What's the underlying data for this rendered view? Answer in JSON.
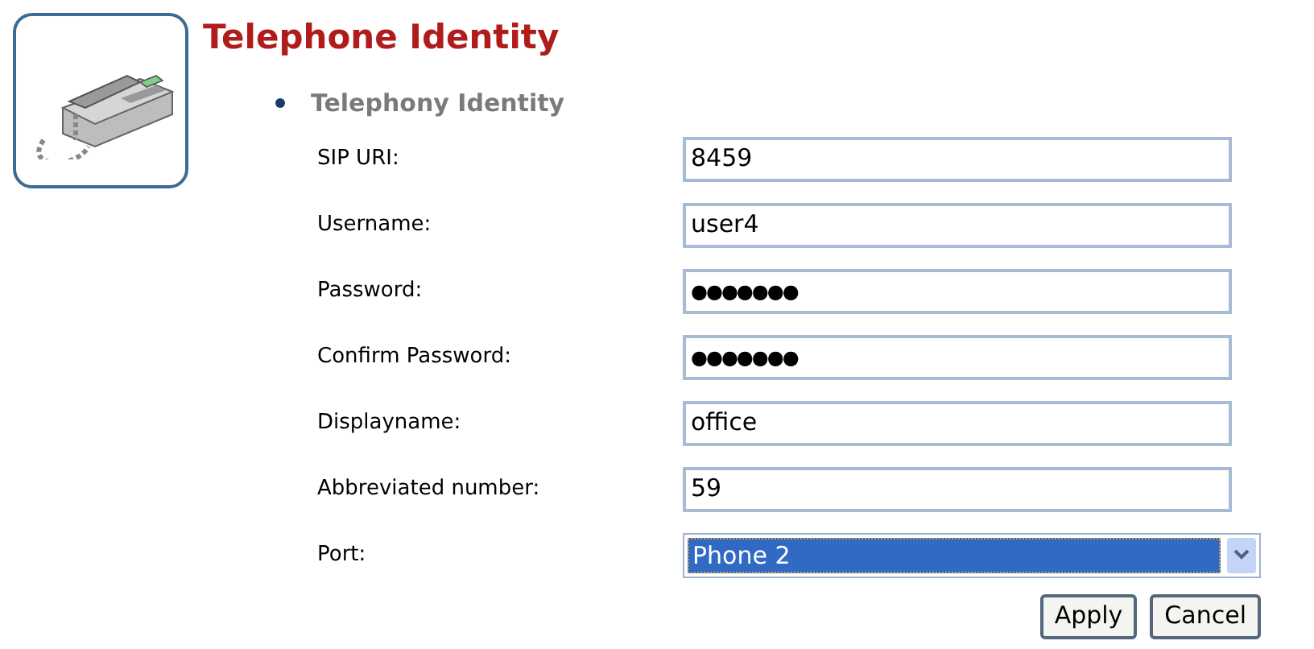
{
  "page": {
    "title": "Telephone Identity"
  },
  "section": {
    "title": "Telephony Identity"
  },
  "fields": [
    {
      "label": "SIP URI:",
      "kind": "text",
      "value": "8459"
    },
    {
      "label": "Username:",
      "kind": "text",
      "value": "user4"
    },
    {
      "label": "Password:",
      "kind": "password",
      "value": "●●●●●●●"
    },
    {
      "label": "Confirm Password:",
      "kind": "password",
      "value": "●●●●●●●"
    },
    {
      "label": "Displayname:",
      "kind": "text",
      "value": "office"
    },
    {
      "label": "Abbreviated number:",
      "kind": "text",
      "value": "59"
    },
    {
      "label": "Port:",
      "kind": "select",
      "value": "Phone 2"
    }
  ],
  "buttons": [
    "Apply",
    "Cancel"
  ]
}
